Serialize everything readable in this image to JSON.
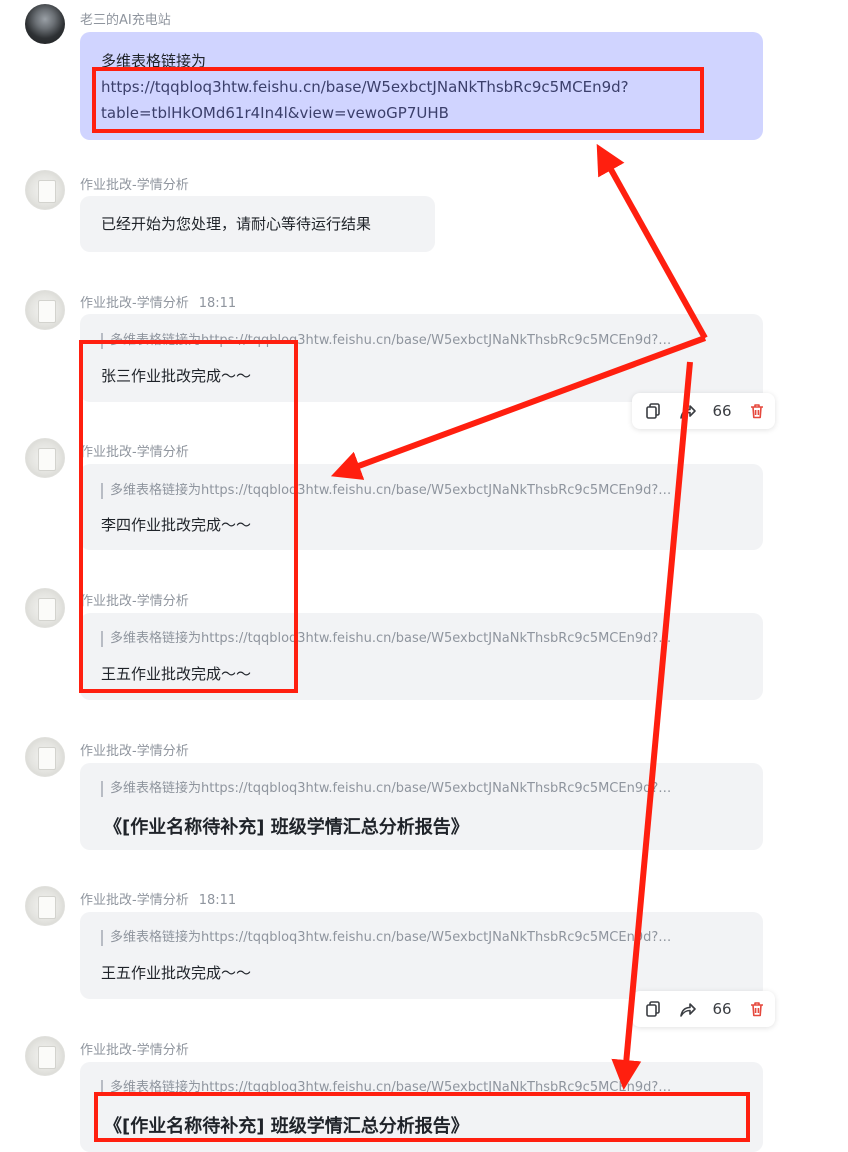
{
  "user": {
    "name": "老三的AI充电站",
    "message_line1": "多维表格链接为",
    "message_link_line1": "https://tqqbloq3htw.feishu.cn/base/W5exbctJNaNkThsbRc9c5MCEn9d?",
    "message_link_line2": "table=tblHkOMd61r4In4l&view=vewoGP7UHB"
  },
  "bot_name": "作业批改-学情分析",
  "timestamp": "18:11",
  "quote_text": "多维表格链接为https://tqqbloq3htw.feishu.cn/base/W5exbctJNaNkThsbRc9c5MCEn9d?…",
  "messages": [
    {
      "text": "已经开始为您处理，请耐心等待运行结果"
    },
    {
      "text": "张三作业批改完成～～"
    },
    {
      "text": "李四作业批改完成～～"
    },
    {
      "text": "王五作业批改完成～～"
    },
    {
      "text": "《[作业名称待补充] 班级学情汇总分析报告》"
    },
    {
      "text": "王五作业批改完成～～"
    },
    {
      "text": "《[作业名称待补充] 班级学情汇总分析报告》"
    }
  ],
  "toolbar": {
    "quote_count": "66"
  },
  "colors": {
    "user_bubble": "#d0d4ff",
    "bot_bubble": "#f2f3f5",
    "annotation_red": "#ff1f0f",
    "delete_icon": "#e5483d"
  },
  "icons": [
    "copy-icon",
    "share-icon",
    "quote-icon",
    "delete-icon"
  ]
}
